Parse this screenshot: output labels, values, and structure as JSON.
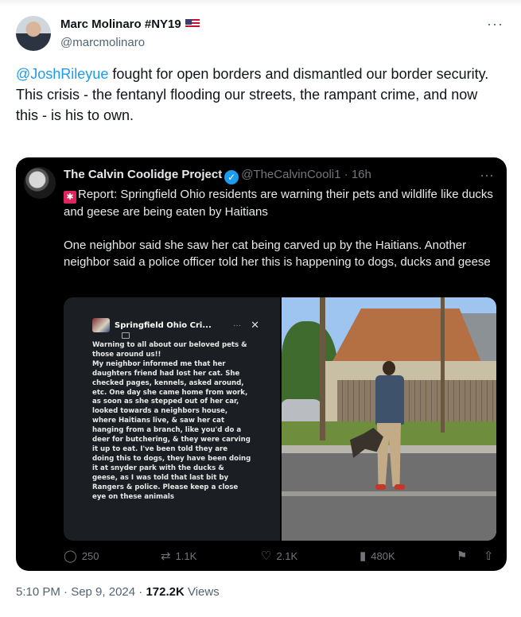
{
  "author": {
    "name": "Marc Molinaro #NY19",
    "handle": "@marcmolinaro",
    "more": "···"
  },
  "tweet": {
    "mention": "@JoshRileyue",
    "text_line1": " fought for open borders and dismantled our border security.",
    "text_line2": "This crisis - the fentanyl flooding our streets, the rampant crime, and now this - is his to own."
  },
  "quoted": {
    "name": "The Calvin Coolidge Project",
    "handle": "@TheCalvinCooli1",
    "time": "· 16h",
    "more": "···",
    "para1": "Report: Springfield Ohio residents are warning their pets and wildlife like ducks and geese are being eaten by Haitians",
    "para2": "One neighbor said she saw her cat being carved up by the Haitians. Another neighbor said a police officer told her this is happening to dogs, ducks and geese",
    "screenshot": {
      "title": "Springfield Ohio Cri...",
      "dots": "···",
      "close": "✕",
      "body": "Warning to all about our beloved pets & those around us!!\nMy neighbor informed me that her daughters friend had lost her cat. She checked pages, kennels, asked around, etc. One day she came home from work, as soon as she stepped out of her car, looked towards a neighbors house, where Haitians live, & saw her cat hanging from a branch, like you'd do a deer for butchering, & they were carving it up to eat. I've been told they are doing this to dogs, they have been doing it at snyder park with the ducks & geese, as I was told that last bit by Rangers & police. Please keep a close eye on these animals"
    },
    "stats": {
      "replies": "250",
      "reposts": "1.1K",
      "likes": "2.1K",
      "views": "480K"
    }
  },
  "footer": {
    "time": "5:10 PM · Sep 9, 2024 · ",
    "views_count": "172.2K",
    "views_label": " Views"
  },
  "icons": {
    "reply": "reply-icon",
    "repost": "repost-icon",
    "like": "heart-icon",
    "views": "views-chart-icon",
    "bookmark": "bookmark-icon",
    "share": "share-icon",
    "verified": "verified-badge-icon",
    "siren": "siren-emoji-icon",
    "flag": "us-flag-icon"
  },
  "colors": {
    "accent": "#1d9bf0",
    "text": "#0f1419",
    "muted": "#536471",
    "quote_bg": "#000000"
  }
}
